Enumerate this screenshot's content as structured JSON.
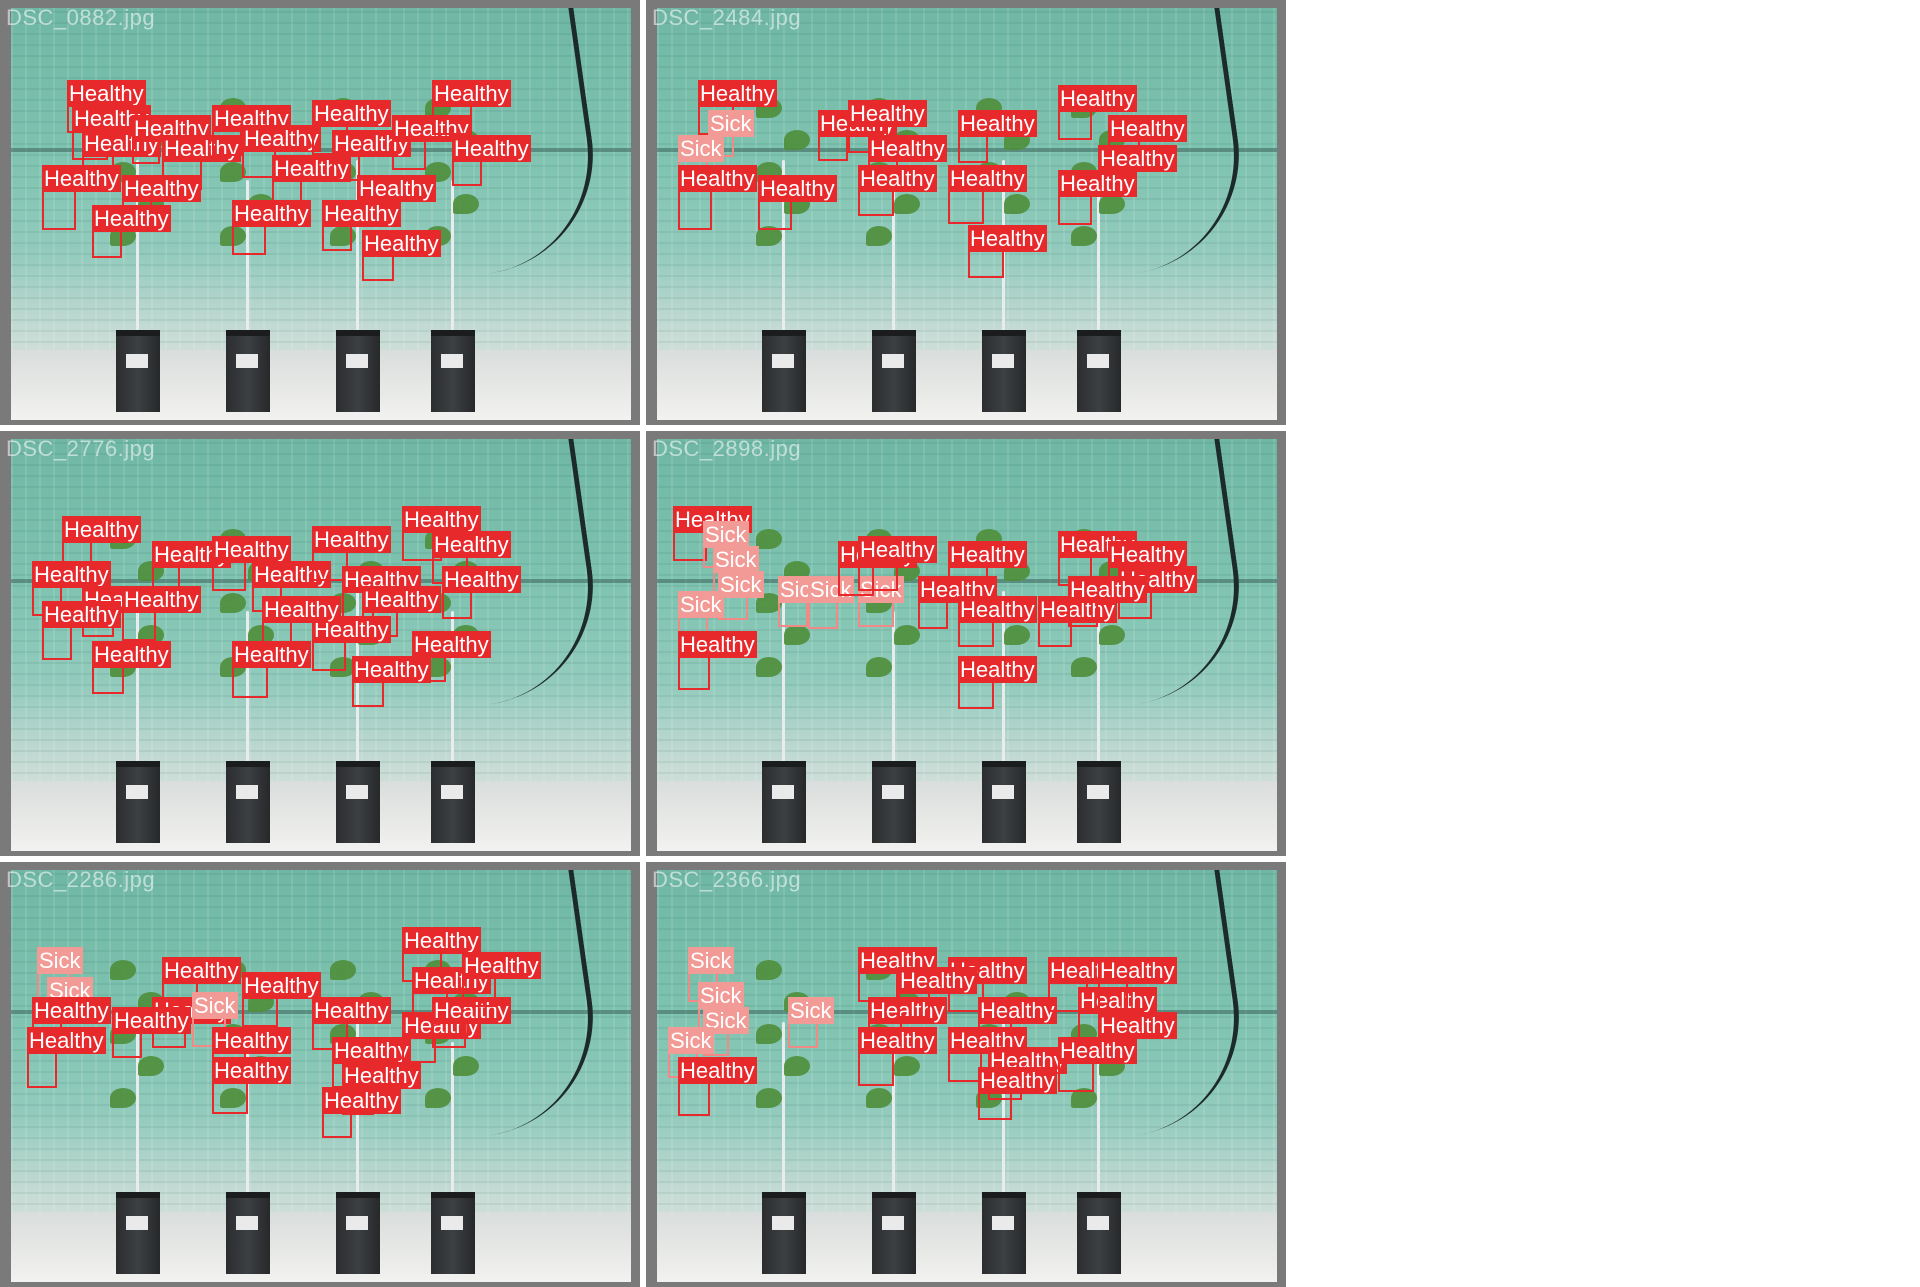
{
  "mosaic": {
    "label_colors": {
      "Healthy": "#e8292c",
      "Sick": "#f29a95"
    },
    "tiles": [
      {
        "filename": "DSC_0882.jpg",
        "detections": [
          {
            "label": "Healthy"
          },
          {
            "label": "Healthy"
          },
          {
            "label": "Healthy"
          },
          {
            "label": "Healthy"
          },
          {
            "label": "Healthy"
          },
          {
            "label": "Healthy"
          },
          {
            "label": "Healthy"
          },
          {
            "label": "Healthy"
          },
          {
            "label": "Healthy"
          },
          {
            "label": "Healthy"
          },
          {
            "label": "Healthy"
          },
          {
            "label": "Healthy"
          },
          {
            "label": "Healthy"
          },
          {
            "label": "Healthy"
          },
          {
            "label": "Healthy"
          },
          {
            "label": "Healthy"
          },
          {
            "label": "Healthy"
          },
          {
            "label": "Healthy"
          },
          {
            "label": "Healthy"
          },
          {
            "label": "Healthy"
          }
        ]
      },
      {
        "filename": "DSC_2484.jpg",
        "detections": [
          {
            "label": "Healthy"
          },
          {
            "label": "Sick"
          },
          {
            "label": "Sick"
          },
          {
            "label": "Healthy"
          },
          {
            "label": "Healthy"
          },
          {
            "label": "Healthy"
          },
          {
            "label": "Healthy"
          },
          {
            "label": "Healthy"
          },
          {
            "label": "Healthy"
          },
          {
            "label": "Healthy"
          },
          {
            "label": "Healthy"
          },
          {
            "label": "Healthy"
          },
          {
            "label": "Healthy"
          },
          {
            "label": "Healthy"
          },
          {
            "label": "Healthy"
          },
          {
            "label": "Healthy"
          }
        ]
      },
      {
        "filename": "DSC_2776.jpg",
        "detections": [
          {
            "label": "Healthy"
          },
          {
            "label": "Healthy"
          },
          {
            "label": "Healthy"
          },
          {
            "label": "Healthy"
          },
          {
            "label": "Healthy"
          },
          {
            "label": "Healthy"
          },
          {
            "label": "Healthy"
          },
          {
            "label": "Healthy"
          },
          {
            "label": "Healthy"
          },
          {
            "label": "Healthy"
          },
          {
            "label": "Healthy"
          },
          {
            "label": "Healthy"
          },
          {
            "label": "Healthy"
          },
          {
            "label": "Healthy"
          },
          {
            "label": "Healthy"
          },
          {
            "label": "Healthy"
          },
          {
            "label": "Healthy"
          },
          {
            "label": "Healthy"
          },
          {
            "label": "Healthy"
          },
          {
            "label": "Healthy"
          }
        ]
      },
      {
        "filename": "DSC_2898.jpg",
        "detections": [
          {
            "label": "Healthy"
          },
          {
            "label": "Sick"
          },
          {
            "label": "Sick"
          },
          {
            "label": "Sick"
          },
          {
            "label": "Sick"
          },
          {
            "label": "Sick"
          },
          {
            "label": "Sick"
          },
          {
            "label": "Sick"
          },
          {
            "label": "Healthy"
          },
          {
            "label": "Healthy"
          },
          {
            "label": "Healthy"
          },
          {
            "label": "Healthy"
          },
          {
            "label": "Healthy"
          },
          {
            "label": "Healthy"
          },
          {
            "label": "Healthy"
          },
          {
            "label": "Healthy"
          },
          {
            "label": "Healthy"
          },
          {
            "label": "Healthy"
          },
          {
            "label": "Healthy"
          },
          {
            "label": "Healthy"
          }
        ]
      },
      {
        "filename": "DSC_2286.jpg",
        "detections": [
          {
            "label": "Sick"
          },
          {
            "label": "Sick"
          },
          {
            "label": "Healthy"
          },
          {
            "label": "Healthy"
          },
          {
            "label": "Healthy"
          },
          {
            "label": "Healthy"
          },
          {
            "label": "Sick"
          },
          {
            "label": "Healthy"
          },
          {
            "label": "Healthy"
          },
          {
            "label": "Healthy"
          },
          {
            "label": "Healthy"
          },
          {
            "label": "Healthy"
          },
          {
            "label": "Healthy"
          },
          {
            "label": "Healthy"
          },
          {
            "label": "Healthy"
          },
          {
            "label": "Healthy"
          },
          {
            "label": "Healthy"
          },
          {
            "label": "Healthy"
          },
          {
            "label": "Healthy"
          },
          {
            "label": "Healthy"
          }
        ]
      },
      {
        "filename": "DSC_2366.jpg",
        "detections": [
          {
            "label": "Sick"
          },
          {
            "label": "Sick"
          },
          {
            "label": "Sick"
          },
          {
            "label": "Sick"
          },
          {
            "label": "Sick"
          },
          {
            "label": "Healthy"
          },
          {
            "label": "Healthy"
          },
          {
            "label": "Healthy"
          },
          {
            "label": "Healthy"
          },
          {
            "label": "Healthy"
          },
          {
            "label": "Healthy"
          },
          {
            "label": "Healthy"
          },
          {
            "label": "Healthy"
          },
          {
            "label": "Healthy"
          },
          {
            "label": "Healthy"
          },
          {
            "label": "Healthy"
          },
          {
            "label": "Healthy"
          },
          {
            "label": "Healthy"
          },
          {
            "label": "Healthy"
          },
          {
            "label": "Healthy"
          }
        ]
      }
    ]
  }
}
